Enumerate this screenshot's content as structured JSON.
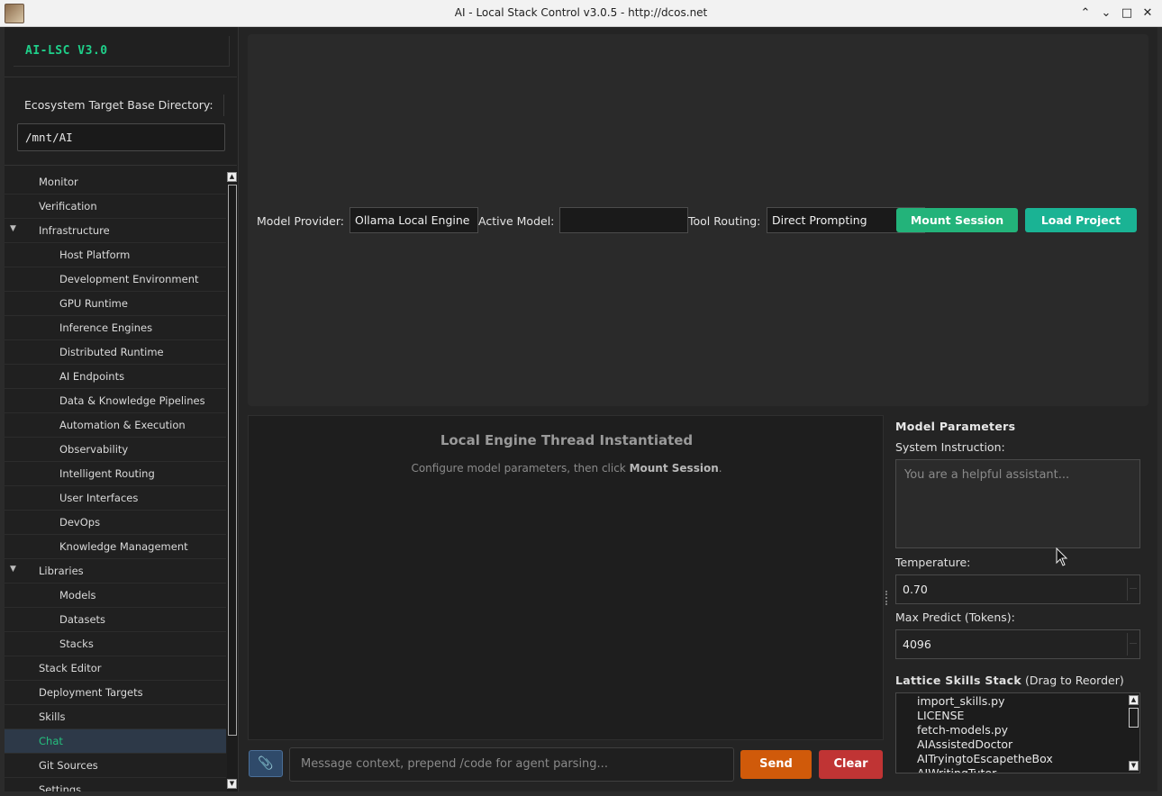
{
  "window": {
    "title": "AI - Local Stack Control v3.0.5 - http://dcos.net",
    "controls": {
      "collapse": "⌃",
      "minimize": "⌄",
      "maximize": "□",
      "close": "✕"
    }
  },
  "sidebar": {
    "brand": "AI-LSC V3.0",
    "dir_label": "Ecosystem Target Base Directory:",
    "dir_value": "/mnt/AI",
    "items": [
      {
        "label": "Monitor"
      },
      {
        "label": "Verification"
      },
      {
        "label": "Infrastructure"
      },
      {
        "label": "Host Platform"
      },
      {
        "label": "Development Environment"
      },
      {
        "label": "GPU Runtime"
      },
      {
        "label": "Inference Engines"
      },
      {
        "label": "Distributed Runtime"
      },
      {
        "label": "AI Endpoints"
      },
      {
        "label": "Data & Knowledge Pipelines"
      },
      {
        "label": "Automation & Execution"
      },
      {
        "label": "Observability"
      },
      {
        "label": "Intelligent Routing"
      },
      {
        "label": "User Interfaces"
      },
      {
        "label": "DevOps"
      },
      {
        "label": "Knowledge Management"
      },
      {
        "label": "Libraries"
      },
      {
        "label": "Models"
      },
      {
        "label": "Datasets"
      },
      {
        "label": "Stacks"
      },
      {
        "label": "Stack Editor"
      },
      {
        "label": "Deployment Targets"
      },
      {
        "label": "Skills"
      },
      {
        "label": "Chat"
      },
      {
        "label": "Git Sources"
      },
      {
        "label": "Settings"
      }
    ],
    "expand_glyph": "▼"
  },
  "toolbar": {
    "provider_label": "Model Provider:",
    "provider_value": "Ollama Local Engine",
    "model_label": "Active Model:",
    "model_value": "",
    "routing_label": "Tool Routing:",
    "routing_value": "Direct Prompting",
    "mount_label": "Mount Session",
    "load_label": "Load Project"
  },
  "chat": {
    "title": "Local Engine Thread Instantiated",
    "sub_prefix": "Configure model parameters, then click ",
    "sub_bold": "Mount Session",
    "sub_suffix": ".",
    "input_placeholder": "Message context, prepend /code for agent parsing...",
    "attach_icon": "📎",
    "send_label": "Send",
    "clear_label": "Clear"
  },
  "params": {
    "heading": "Model Parameters",
    "system_label": "System Instruction:",
    "system_placeholder": "You are a helpful assistant...",
    "temperature_label": "Temperature:",
    "temperature_value": "0.70",
    "max_predict_label": "Max Predict (Tokens):",
    "max_predict_value": "4096",
    "skills_heading": "Lattice Skills Stack",
    "skills_hint": " (Drag to Reorder)",
    "skills": [
      "import_skills.py",
      "LICENSE",
      "fetch-models.py",
      "AIAssistedDoctor",
      "AITryingtoEscapetheBox",
      "AIWritingTutor"
    ]
  },
  "colors": {
    "accent_green": "#1fd08a",
    "mount_btn": "#23b37a",
    "load_btn": "#1ab394",
    "send_btn": "#d05a0a",
    "clear_btn": "#c03434"
  }
}
